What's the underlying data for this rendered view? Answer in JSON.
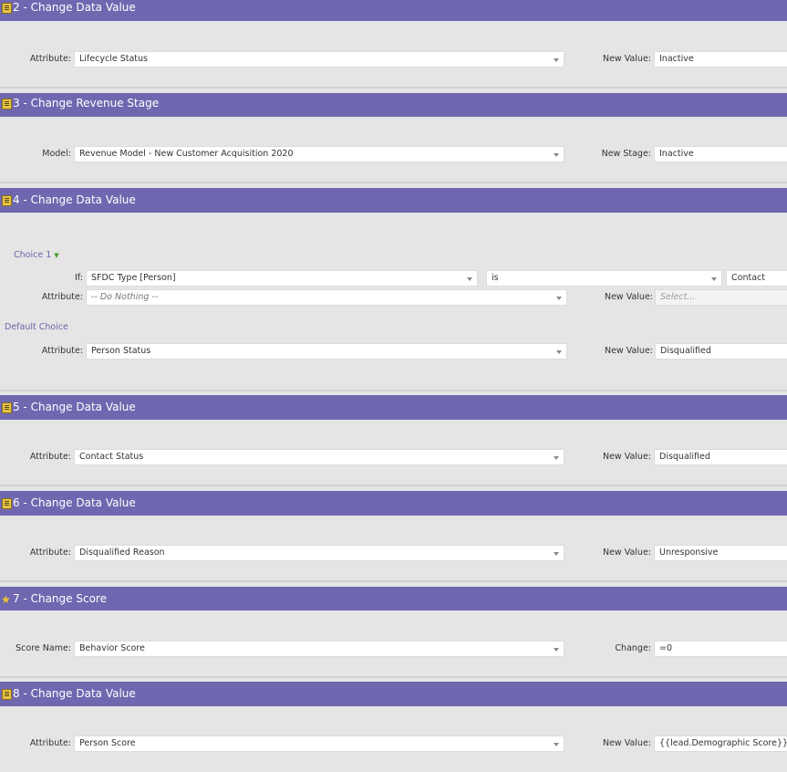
{
  "steps": [
    {
      "title": "2 - Change Data Value",
      "label": "Attribute:",
      "value": "Lifecycle Status",
      "new_label": "New Value:",
      "new_value": "Inactive"
    },
    {
      "title": "3 - Change Revenue Stage",
      "label": "Model:",
      "value": "Revenue Model - New Customer Acquisition 2020",
      "new_label": "New Stage:",
      "new_value": "Inactive"
    },
    {
      "title": "4 - Change Data Value",
      "choice_label": "Choice 1",
      "if_label": "If:",
      "if_field": "SFDC Type [Person]",
      "if_operator": "is",
      "if_value": "Contact",
      "choice_attr_label": "Attribute:",
      "choice_attr_value": "-- Do Nothing --",
      "choice_new_label": "New Value:",
      "choice_new_placeholder": "Select...",
      "default_label": "Default Choice",
      "label": "Attribute:",
      "value": "Person Status",
      "new_label": "New Value:",
      "new_value": "Disqualified"
    },
    {
      "title": "5 - Change Data Value",
      "label": "Attribute:",
      "value": "Contact Status",
      "new_label": "New Value:",
      "new_value": "Disqualified"
    },
    {
      "title": "6 - Change Data Value",
      "label": "Attribute:",
      "value": "Disqualified Reason",
      "new_label": "New Value:",
      "new_value": "Unresponsive"
    },
    {
      "title": "7 - Change Score",
      "label": "Score Name:",
      "value": "Behavior Score",
      "new_label": "Change:",
      "new_value": "=0"
    },
    {
      "title": "8 - Change Data Value",
      "label": "Attribute:",
      "value": "Person Score",
      "new_label": "New Value:",
      "new_value": "{{lead.Demographic Score}}"
    }
  ],
  "icons": {
    "step_icon": "flow-step-icon",
    "score_icon": "star-icon"
  },
  "colors": {
    "header_bg": "#6f68b0",
    "panel_bg": "#e5e5e5",
    "choice_text": "#6a63ad"
  }
}
